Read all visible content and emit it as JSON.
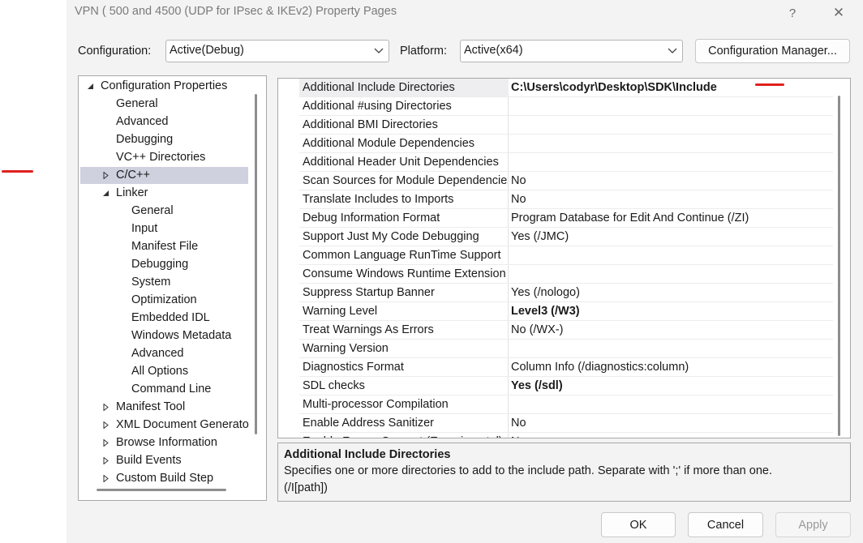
{
  "window": {
    "title": "VPN ( 500 and 4500 (UDP for IPsec & IKEv2) Property Pages",
    "help_glyph": "?",
    "close_glyph": "✕"
  },
  "toolbar": {
    "configuration_label": "Configuration:",
    "configuration_value": "Active(Debug)",
    "platform_label": "Platform:",
    "platform_value": "Active(x64)",
    "config_manager_label": "Configuration Manager..."
  },
  "tree": {
    "items": [
      {
        "label": "Configuration Properties",
        "expander": "expanded"
      },
      {
        "label": "General",
        "expander": "none"
      },
      {
        "label": "Advanced",
        "expander": "none"
      },
      {
        "label": "Debugging",
        "expander": "none"
      },
      {
        "label": "VC++ Directories",
        "expander": "none"
      },
      {
        "label": "C/C++",
        "expander": "collapsed",
        "selected": true
      },
      {
        "label": "Linker",
        "expander": "expanded"
      },
      {
        "label": "General",
        "expander": "none"
      },
      {
        "label": "Input",
        "expander": "none"
      },
      {
        "label": "Manifest File",
        "expander": "none"
      },
      {
        "label": "Debugging",
        "expander": "none"
      },
      {
        "label": "System",
        "expander": "none"
      },
      {
        "label": "Optimization",
        "expander": "none"
      },
      {
        "label": "Embedded IDL",
        "expander": "none"
      },
      {
        "label": "Windows Metadata",
        "expander": "none"
      },
      {
        "label": "Advanced",
        "expander": "none"
      },
      {
        "label": "All Options",
        "expander": "none"
      },
      {
        "label": "Command Line",
        "expander": "none"
      },
      {
        "label": "Manifest Tool",
        "expander": "collapsed"
      },
      {
        "label": "XML Document Generato",
        "expander": "collapsed"
      },
      {
        "label": "Browse Information",
        "expander": "collapsed"
      },
      {
        "label": "Build Events",
        "expander": "collapsed"
      },
      {
        "label": "Custom Build Step",
        "expander": "collapsed"
      }
    ]
  },
  "properties": {
    "rows": [
      {
        "name": "Additional Include Directories",
        "value": "C:\\Users\\codyr\\Desktop\\SDK\\Include",
        "bold": true,
        "selected": true
      },
      {
        "name": "Additional #using Directories",
        "value": ""
      },
      {
        "name": "Additional BMI Directories",
        "value": ""
      },
      {
        "name": "Additional Module Dependencies",
        "value": ""
      },
      {
        "name": "Additional Header Unit Dependencies",
        "value": ""
      },
      {
        "name": "Scan Sources for Module Dependencies",
        "value": "No"
      },
      {
        "name": "Translate Includes to Imports",
        "value": "No"
      },
      {
        "name": "Debug Information Format",
        "value": "Program Database for Edit And Continue (/ZI)"
      },
      {
        "name": "Support Just My Code Debugging",
        "value": "Yes (/JMC)"
      },
      {
        "name": "Common Language RunTime Support",
        "value": ""
      },
      {
        "name": "Consume Windows Runtime Extension",
        "value": ""
      },
      {
        "name": "Suppress Startup Banner",
        "value": "Yes (/nologo)"
      },
      {
        "name": "Warning Level",
        "value": "Level3 (/W3)",
        "bold": true
      },
      {
        "name": "Treat Warnings As Errors",
        "value": "No (/WX-)"
      },
      {
        "name": "Warning Version",
        "value": ""
      },
      {
        "name": "Diagnostics Format",
        "value": "Column Info (/diagnostics:column)"
      },
      {
        "name": "SDL checks",
        "value": "Yes (/sdl)",
        "bold": true
      },
      {
        "name": "Multi-processor Compilation",
        "value": ""
      },
      {
        "name": "Enable Address Sanitizer",
        "value": "No"
      },
      {
        "name": "Enable Fuzzer Support (Experimental)",
        "value": "No"
      }
    ]
  },
  "description": {
    "title": "Additional Include Directories",
    "text": "Specifies one or more directories to add to the include path. Separate with ';' if more than one.",
    "switch": "(/I[path])"
  },
  "buttons": {
    "ok": "OK",
    "cancel": "Cancel",
    "apply": "Apply"
  },
  "colors": {
    "annotation_red": "#e0201d",
    "selected_tree_item": "#cfd1df",
    "disabled_text": "#9a9a9a"
  }
}
